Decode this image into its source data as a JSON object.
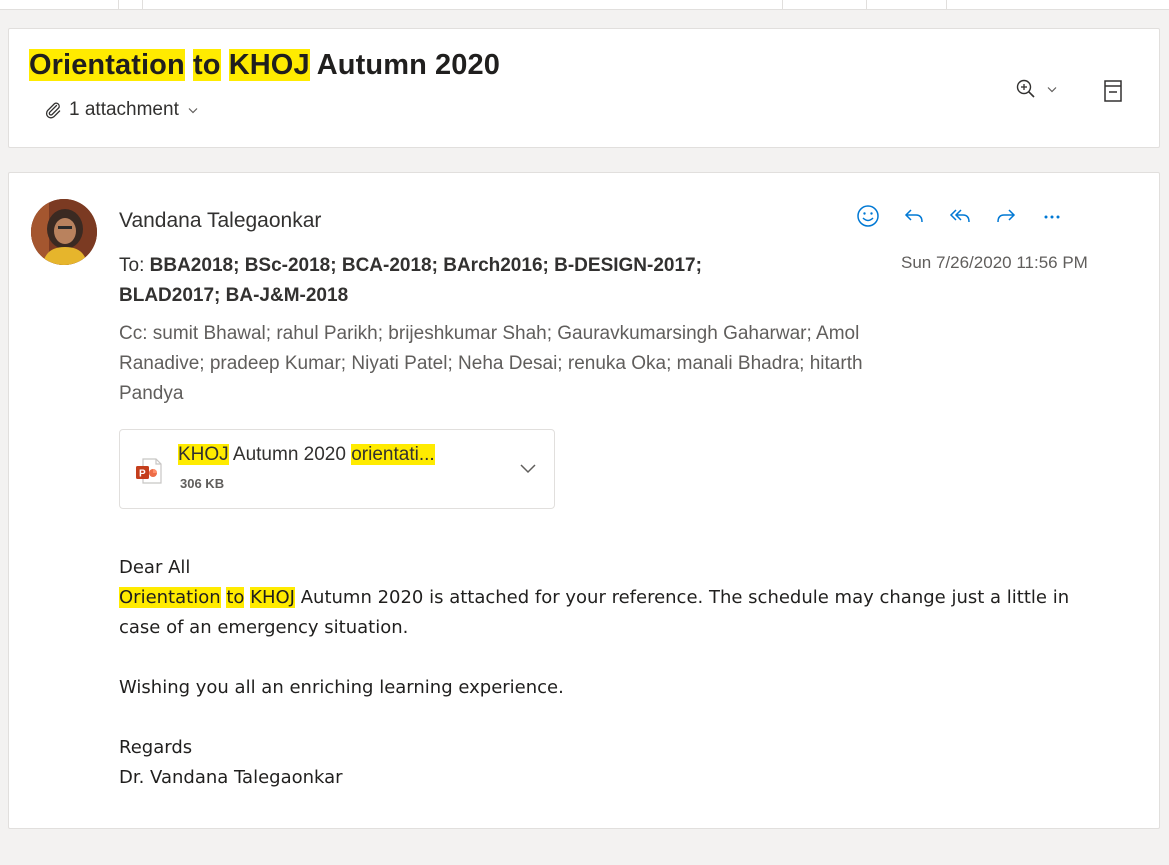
{
  "colors": {
    "highlight": "#ffeb00",
    "accent": "#0078d4",
    "ppt": "#c43e1c"
  },
  "header": {
    "subject_parts": [
      {
        "text": "Orientation",
        "highlight": true
      },
      {
        "text": " ",
        "highlight": false
      },
      {
        "text": "to",
        "highlight": true
      },
      {
        "text": " ",
        "highlight": false
      },
      {
        "text": "KHOJ",
        "highlight": true
      },
      {
        "text": " Autumn 2020",
        "highlight": false
      }
    ],
    "attachment_count_label": "1 attachment",
    "icons": [
      "paperclip-icon",
      "chevron-down-icon",
      "zoom-in-icon",
      "popout-icon"
    ]
  },
  "message": {
    "sender": "Vandana Talegaonkar",
    "to_label": "To:",
    "to_recipients": [
      "BBA2018;",
      "BSc-2018;",
      "BCA-2018;",
      "BArch2016;",
      "B-DESIGN-2017;",
      "BLAD2017;",
      "BA-J&M-2018"
    ],
    "date": "Sun 7/26/2020 11:56 PM",
    "cc_label": "Cc:",
    "cc_recipients": [
      "sumit Bhawal;",
      "rahul Parikh;",
      "brijeshkumar Shah;",
      "Gauravkumarsingh Gaharwar;",
      "Amol Ranadive;",
      "pradeep Kumar;",
      "Niyati Patel;",
      "Neha Desai;",
      "renuka Oka;",
      "manali Bhadra;",
      "hitarth Pandya"
    ],
    "actions": [
      "emoji-reaction-icon",
      "reply-icon",
      "reply-all-icon",
      "forward-icon",
      "more-options-icon"
    ]
  },
  "attachment": {
    "name_parts": [
      {
        "text": "KHOJ",
        "highlight": true
      },
      {
        "text": " Autumn 2020 ",
        "highlight": false
      },
      {
        "text": "orientati...",
        "highlight": true
      }
    ],
    "size": "306 KB",
    "icon": "powerpoint-file-icon"
  },
  "body": {
    "greeting": "Dear All",
    "para1_parts": [
      {
        "text": "Orientation",
        "highlight": true
      },
      {
        "text": " ",
        "highlight": false
      },
      {
        "text": "to",
        "highlight": true
      },
      {
        "text": " ",
        "highlight": false
      },
      {
        "text": "KHOJ",
        "highlight": true
      },
      {
        "text": " Autumn 2020 is attached for your reference. The schedule may change just a little in case of  an emergency situation.",
        "highlight": false
      }
    ],
    "para2": "Wishing you all an enriching learning experience.",
    "closing": "Regards",
    "signature": "Dr. Vandana Talegaonkar"
  }
}
